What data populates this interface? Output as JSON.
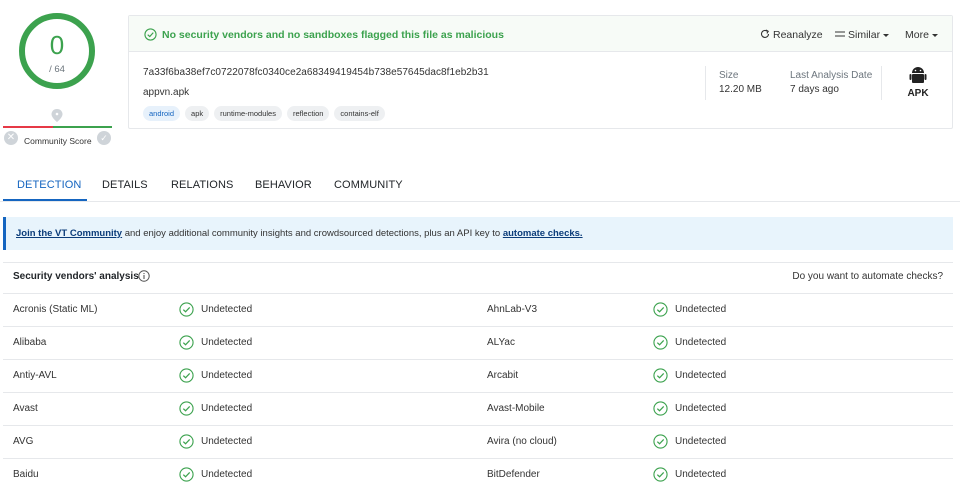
{
  "score": {
    "detections": "0",
    "total": "/ 64",
    "community_label": "Community Score"
  },
  "banner": {
    "text": "No security vendors and no sandboxes flagged this file as malicious"
  },
  "actions": {
    "reanalyze": "Reanalyze",
    "similar": "Similar",
    "more": "More"
  },
  "file": {
    "hash": "7a33f6ba38ef7c0722078fc0340ce2a68349419454b738e57645dac8f1eb2b31",
    "name": "appvn.apk",
    "tags": [
      "android",
      "apk",
      "runtime-modules",
      "reflection",
      "contains-elf"
    ],
    "size_label": "Size",
    "size_value": "12.20 MB",
    "analysis_label": "Last Analysis Date",
    "analysis_value": "7 days ago",
    "type_badge": "APK"
  },
  "tabs": [
    "DETECTION",
    "DETAILS",
    "RELATIONS",
    "BEHAVIOR",
    "COMMUNITY"
  ],
  "strip": {
    "link1": "Join the VT Community",
    "middle": " and enjoy additional community insights and crowdsourced detections, plus an API key to ",
    "link2": "automate checks."
  },
  "vendors": {
    "title": "Security vendors' analysis",
    "right_text": "Do you want to automate checks?",
    "rows": [
      {
        "left": "Acronis (Static ML)",
        "left_result": "Undetected",
        "right": "AhnLab-V3",
        "right_result": "Undetected"
      },
      {
        "left": "Alibaba",
        "left_result": "Undetected",
        "right": "ALYac",
        "right_result": "Undetected"
      },
      {
        "left": "Antiy-AVL",
        "left_result": "Undetected",
        "right": "Arcabit",
        "right_result": "Undetected"
      },
      {
        "left": "Avast",
        "left_result": "Undetected",
        "right": "Avast-Mobile",
        "right_result": "Undetected"
      },
      {
        "left": "AVG",
        "left_result": "Undetected",
        "right": "Avira (no cloud)",
        "right_result": "Undetected"
      },
      {
        "left": "Baidu",
        "left_result": "Undetected",
        "right": "BitDefender",
        "right_result": "Undetected"
      }
    ]
  },
  "colors": {
    "green": "#3ca24e",
    "blue": "#1565c0",
    "strip_bg": "#e8f4fc"
  }
}
